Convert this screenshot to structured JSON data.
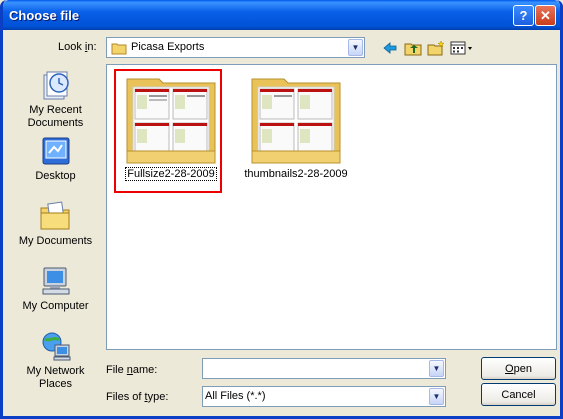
{
  "window": {
    "title": "Choose file"
  },
  "titlebar": {
    "help_glyph": "?",
    "close_glyph": "✕"
  },
  "lookin": {
    "label_pre": "Look ",
    "label_key": "i",
    "label_post": "n:",
    "value": "Picasa Exports"
  },
  "toolbar": {
    "icons": [
      "back-arrow-icon",
      "up-folder-icon",
      "new-folder-icon",
      "views-menu-icon"
    ]
  },
  "places": [
    {
      "label": "My Recent Documents",
      "icon": "recent-documents-icon"
    },
    {
      "label": "Desktop",
      "icon": "desktop-icon"
    },
    {
      "label": "My Documents",
      "icon": "my-documents-icon"
    },
    {
      "label": "My Computer",
      "icon": "my-computer-icon"
    },
    {
      "label": "My Network Places",
      "icon": "network-places-icon"
    }
  ],
  "files": [
    {
      "name": "Fullsize2-28-2009",
      "selected": true
    },
    {
      "name": "thumbnails2-28-2009",
      "selected": false
    }
  ],
  "filename": {
    "label_pre": "File ",
    "label_key": "n",
    "label_post": "ame:",
    "value": ""
  },
  "filetype": {
    "label_pre": "Files of ",
    "label_key": "t",
    "label_post": "ype:",
    "value": "All Files (*.*)"
  },
  "buttons": {
    "open_key": "O",
    "open_rest": "pen",
    "cancel": "Cancel"
  },
  "colors": {
    "title_bar": "#0a5fe8",
    "selection_outline": "#e00000",
    "folder_yellow": "#f3d46a"
  }
}
